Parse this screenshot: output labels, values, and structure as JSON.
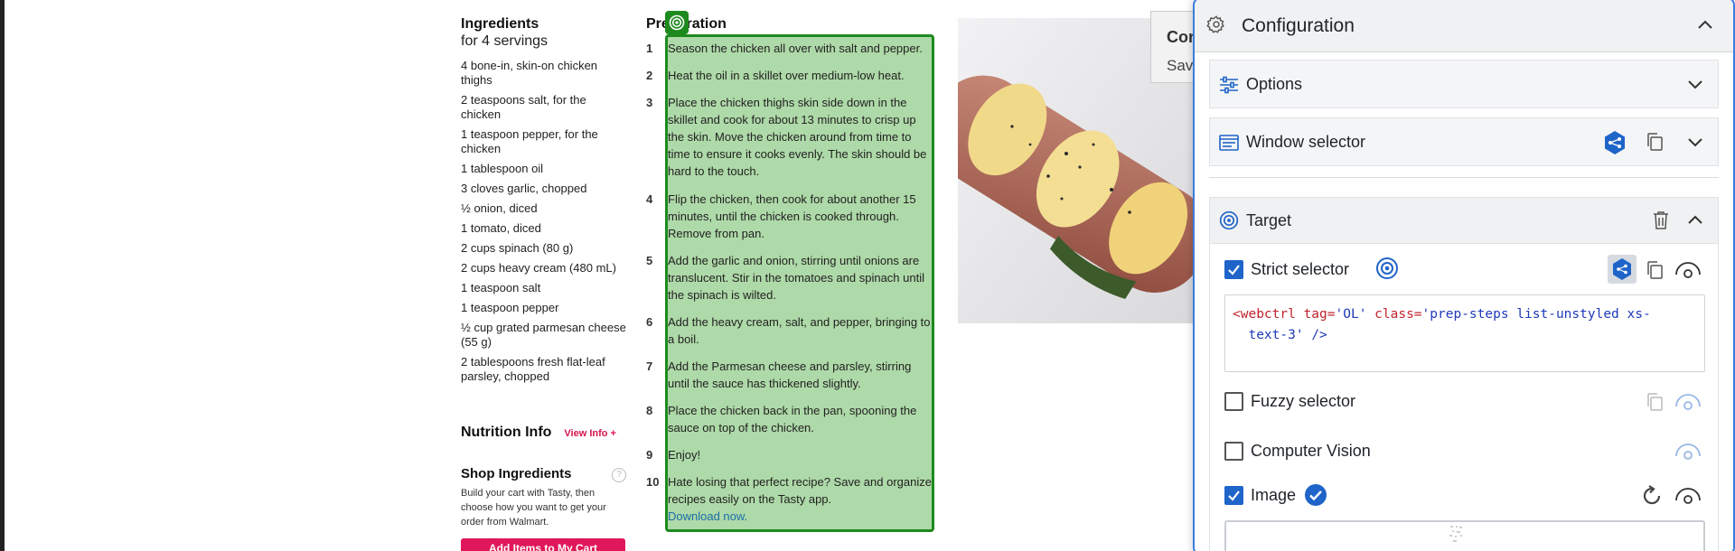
{
  "ingredients": {
    "title": "Ingredients",
    "servings": "for 4 servings",
    "items": [
      "4 bone-in, skin-on chicken thighs",
      "2 teaspoons salt, for the chicken",
      "1 teaspoon pepper, for the chicken",
      "1 tablespoon oil",
      "3 cloves garlic, chopped",
      "½ onion, diced",
      "1 tomato, diced",
      "2 cups spinach (80 g)",
      "2 cups heavy cream (480 mL)",
      "1 teaspoon salt",
      "1 teaspoon pepper",
      "½ cup grated parmesan cheese (55 g)",
      "2 tablespoons fresh flat-leaf parsley, chopped"
    ]
  },
  "nutrition": {
    "title": "Nutrition Info",
    "view_link": "View Info +"
  },
  "shop": {
    "title": "Shop Ingredients",
    "help_glyph": "?",
    "description": "Build your cart with Tasty, then choose how you want to get your order from Walmart.",
    "button": "Add Items to My Cart"
  },
  "preparation": {
    "title": "Preparation",
    "steps": [
      {
        "num": "1",
        "text": "Season the chicken all over with salt and pepper."
      },
      {
        "num": "2",
        "text": "Heat the oil in a skillet over medium-low heat."
      },
      {
        "num": "3",
        "text": "Place the chicken thighs skin side down in the skillet and cook for about 13 minutes to crisp up the skin. Move the chicken around from time to time to ensure it cooks evenly. The skin should be hard to the touch."
      },
      {
        "num": "4",
        "text": "Flip the chicken, then cook for about another 15 minutes, until the chicken is cooked through. Remove from pan."
      },
      {
        "num": "5",
        "text": "Add the garlic and onion, stirring until onions are translucent. Stir in the tomatoes and spinach until the spinach is wilted."
      },
      {
        "num": "6",
        "text": "Add the heavy cream, salt, and pepper, bringing to a boil."
      },
      {
        "num": "7",
        "text": "Add the Parmesan cheese and parsley, stirring until the sauce has thickened slightly."
      },
      {
        "num": "8",
        "text": "Place the chicken back in the pan, spooning the sauce on top of the chicken."
      },
      {
        "num": "9",
        "text": "Enjoy!"
      },
      {
        "num": "10",
        "text": "Hate losing that perfect recipe? Save and organize recipes easily on the Tasty app.",
        "link": "Download now."
      }
    ]
  },
  "background_dialog": {
    "title_fragment": "Cor",
    "text_fragment": "Save"
  },
  "config_panel": {
    "title": "Configuration",
    "sections": {
      "options": "Options",
      "window_selector": "Window selector",
      "target": "Target"
    },
    "strict_selector": {
      "label": "Strict selector",
      "checked": true,
      "code_line1_tag": "<webctrl",
      "code_line1_attr1": "tag=",
      "code_line1_val1": "'OL'",
      "code_line1_attr2": "class=",
      "code_line1_val2": "'prep-steps list-unstyled xs-",
      "code_line2": "text-3'",
      "code_line2_close": "/>"
    },
    "fuzzy_selector": {
      "label": "Fuzzy selector",
      "checked": false
    },
    "computer_vision": {
      "label": "Computer Vision",
      "checked": false
    },
    "image": {
      "label": "Image",
      "checked": true
    }
  },
  "colors": {
    "highlight_fill": "#aed9a8",
    "highlight_border": "#1e8a1e",
    "accent_blue": "#1f64c8",
    "link_pink": "#d6154e",
    "cart_button": "#e0175a"
  }
}
